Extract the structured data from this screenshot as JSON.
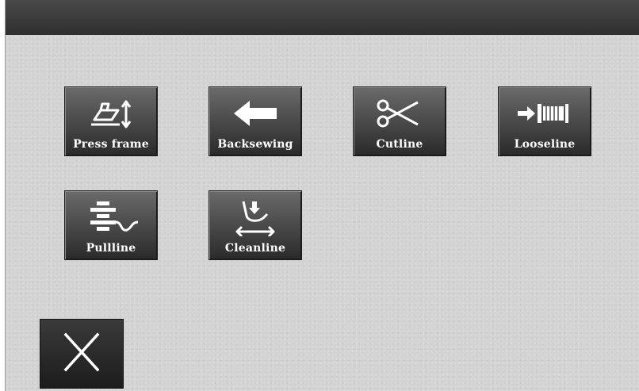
{
  "buttons": [
    {
      "label": "Press frame",
      "icon": "press-frame-icon"
    },
    {
      "label": "Backsewing",
      "icon": "left-arrow-icon"
    },
    {
      "label": "Cutline",
      "icon": "scissors-icon"
    },
    {
      "label": "Looseline",
      "icon": "loose-thread-icon"
    },
    {
      "label": "Pullline",
      "icon": "pull-thread-icon"
    },
    {
      "label": "Cleanline",
      "icon": "clean-thread-icon"
    }
  ],
  "close": {
    "icon": "close-icon"
  },
  "colors": {
    "panel": "#d3d3d3",
    "topbar": "#333333",
    "button": "#4a4a4a",
    "text": "#ffffff"
  }
}
